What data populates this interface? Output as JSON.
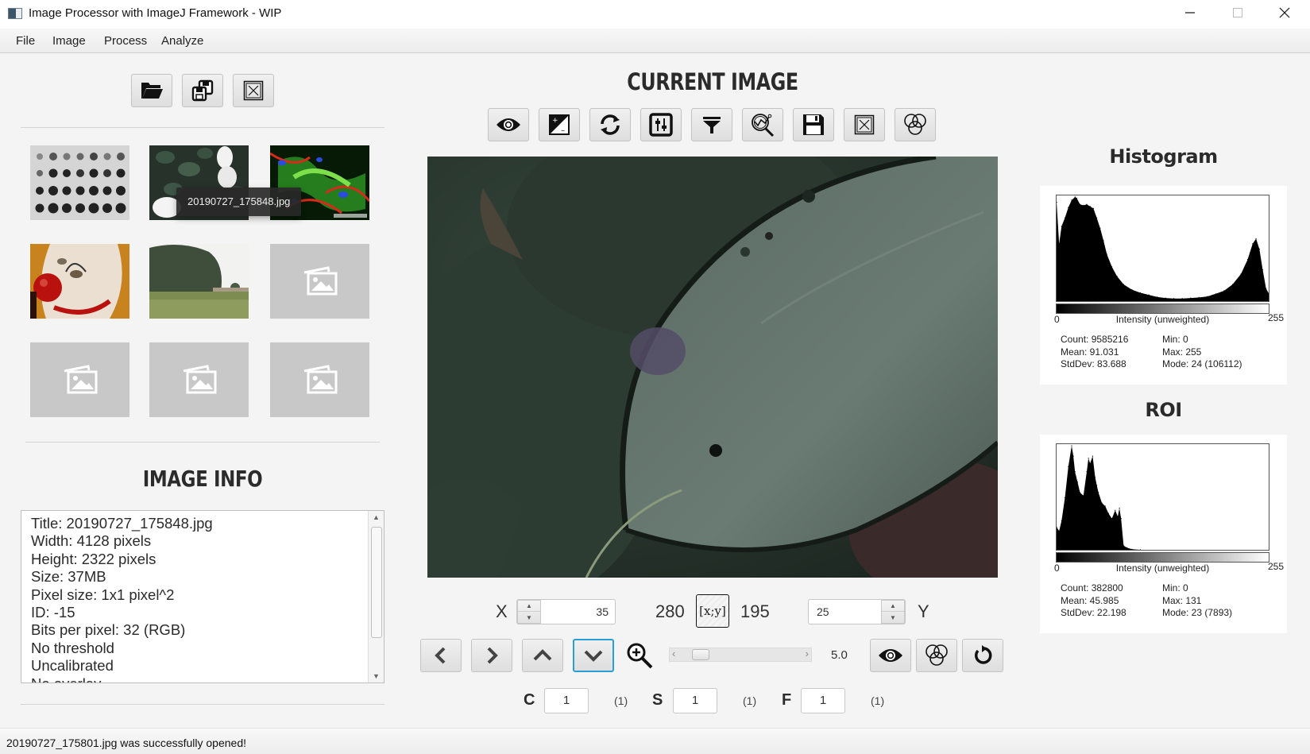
{
  "window": {
    "title": "Image Processor with ImageJ Framework - WIP",
    "controls": {
      "minimize": "—",
      "maximize": "☐",
      "close": "✕"
    }
  },
  "menu": [
    "File",
    "Image",
    "Process",
    "Analyze"
  ],
  "left_toolbar": [
    {
      "name": "open-button",
      "icon": "folder-open-icon",
      "tooltip": ""
    },
    {
      "name": "save-all-button",
      "icon": "save-multiple-icon",
      "tooltip": ""
    },
    {
      "name": "close-button",
      "icon": "close-image-icon",
      "tooltip": ""
    }
  ],
  "gallery": {
    "thumbnails": [
      {
        "kind": "dot-array",
        "placeholder": false
      },
      {
        "kind": "white-roses",
        "placeholder": false
      },
      {
        "kind": "fluorescent-cells",
        "placeholder": false
      },
      {
        "kind": "clown",
        "placeholder": false
      },
      {
        "kind": "tree-field",
        "placeholder": false
      },
      {
        "kind": "empty",
        "placeholder": true
      },
      {
        "kind": "empty",
        "placeholder": true
      },
      {
        "kind": "empty",
        "placeholder": true
      },
      {
        "kind": "empty",
        "placeholder": true
      }
    ],
    "tooltip": "20190727_175848.jpg"
  },
  "image_info": {
    "heading": "IMAGE INFO",
    "lines": [
      "Title: 20190727_175848.jpg",
      "Width:  4128 pixels",
      "Height:  2322 pixels",
      "Size:  37MB",
      "Pixel size: 1x1 pixel^2",
      "ID: -15",
      "Bits per pixel: 32 (RGB)",
      "No threshold",
      "Uncalibrated",
      "No overlay"
    ]
  },
  "current_image": {
    "heading": "CURRENT IMAGE",
    "toolbar": [
      {
        "name": "view-button",
        "icon": "eye-icon"
      },
      {
        "name": "brightness-contrast-button",
        "icon": "contrast-icon"
      },
      {
        "name": "rotate-button",
        "icon": "refresh-icon"
      },
      {
        "name": "adjust-button",
        "icon": "sliders-icon"
      },
      {
        "name": "filter-button",
        "icon": "filter-icon"
      },
      {
        "name": "analyze-button",
        "icon": "analyze-zoom-icon"
      },
      {
        "name": "save-button",
        "icon": "floppy-icon"
      },
      {
        "name": "close-image-button",
        "icon": "close-image-icon"
      },
      {
        "name": "channels-button",
        "icon": "rgb-circles-icon"
      }
    ]
  },
  "roi_controls": {
    "x_label": "X",
    "x_value": "35",
    "coord_x": "280",
    "xy_button": "[x;y]",
    "coord_y": "195",
    "y_value": "25",
    "y_label": "Y",
    "zoom_value": "5.0",
    "zoom_slider_fraction": 0.1
  },
  "navigation": [
    {
      "name": "nav-left-button",
      "icon": "chevron-left-icon",
      "selected": false
    },
    {
      "name": "nav-right-button",
      "icon": "chevron-right-icon",
      "selected": false
    },
    {
      "name": "nav-up-button",
      "icon": "chevron-up-icon",
      "selected": false
    },
    {
      "name": "nav-down-button",
      "icon": "chevron-down-icon",
      "selected": true
    }
  ],
  "right_actions": [
    {
      "name": "show-roi-button",
      "icon": "eye-icon"
    },
    {
      "name": "roi-channels-button",
      "icon": "rgb-circles-icon"
    },
    {
      "name": "reset-button",
      "icon": "reset-icon"
    }
  ],
  "hyperstack": {
    "c_label": "C",
    "c_value": "1",
    "c_total": "(1)",
    "s_label": "S",
    "s_value": "1",
    "s_total": "(1)",
    "f_label": "F",
    "f_value": "1",
    "f_total": "(1)"
  },
  "histogram": {
    "heading": "Histogram",
    "axis_min": "0",
    "axis_max": "255",
    "axis_label": "Intensity (unweighted)",
    "stats_left": [
      "Count: 9585216",
      "Mean: 91.031",
      "StdDev: 83.688"
    ],
    "stats_right": [
      "Min: 0",
      "Max: 255",
      "Mode: 24 (106112)"
    ]
  },
  "roi": {
    "heading": "ROI",
    "axis_min": "0",
    "axis_max": "255",
    "axis_label": "Intensity (unweighted)",
    "stats_left": [
      "Count: 382800",
      "Mean: 45.985",
      "StdDev: 22.198"
    ],
    "stats_right": [
      "Min: 0",
      "Max: 131",
      "Mode: 23 (7893)"
    ]
  },
  "chart_data": [
    {
      "type": "area",
      "title": "Histogram",
      "xlabel": "Intensity (unweighted)",
      "xlim": [
        0,
        255
      ],
      "x": [
        0,
        3,
        6,
        10,
        14,
        18,
        22,
        24,
        28,
        32,
        36,
        40,
        44,
        48,
        52,
        56,
        60,
        66,
        72,
        80,
        90,
        100,
        110,
        120,
        130,
        140,
        150,
        160,
        170,
        180,
        190,
        200,
        210,
        220,
        228,
        234,
        238,
        242,
        246,
        250,
        255
      ],
      "values": [
        0.95,
        0.55,
        0.72,
        0.8,
        0.9,
        0.97,
        1.0,
        0.99,
        0.93,
        0.92,
        0.93,
        0.91,
        0.89,
        0.8,
        0.7,
        0.58,
        0.45,
        0.33,
        0.24,
        0.16,
        0.11,
        0.08,
        0.06,
        0.04,
        0.03,
        0.025,
        0.025,
        0.03,
        0.035,
        0.045,
        0.07,
        0.1,
        0.16,
        0.26,
        0.4,
        0.55,
        0.6,
        0.5,
        0.3,
        0.12,
        0.05
      ]
    },
    {
      "type": "area",
      "title": "ROI",
      "xlabel": "Intensity (unweighted)",
      "xlim": [
        0,
        255
      ],
      "x": [
        0,
        3,
        6,
        10,
        14,
        18,
        20,
        22,
        25,
        28,
        32,
        36,
        38,
        40,
        43,
        46,
        48,
        50,
        54,
        58,
        62,
        66,
        70,
        73,
        75,
        77,
        80,
        84,
        90,
        100,
        255
      ],
      "values": [
        0.22,
        0.18,
        0.28,
        0.5,
        0.8,
        1.0,
        0.9,
        0.75,
        0.65,
        0.55,
        0.52,
        0.75,
        0.88,
        0.83,
        0.9,
        0.7,
        0.62,
        0.55,
        0.45,
        0.42,
        0.35,
        0.3,
        0.38,
        0.32,
        0.4,
        0.3,
        0.04,
        0.02,
        0.005,
        0.0,
        0.0
      ]
    }
  ],
  "status": "20190727_175801.jpg was successfully opened!"
}
